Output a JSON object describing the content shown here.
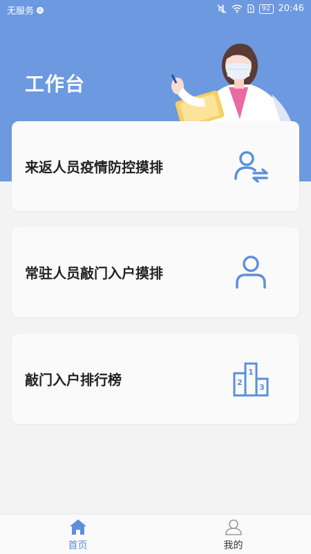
{
  "colors": {
    "accent": "#6c99e0",
    "icon_blue": "#5b8fdc",
    "background": "#f3f3f3",
    "card": "#fafafa"
  },
  "status_bar": {
    "carrier": "无服务",
    "battery": "92",
    "time": "20:46",
    "icons": [
      "mute-icon",
      "wifi-icon",
      "sim-icon",
      "battery-icon"
    ]
  },
  "header": {
    "title": "工作台"
  },
  "cards": [
    {
      "label": "来返人员疫情防控摸排",
      "icon": "person-swap-icon"
    },
    {
      "label": "常驻人员敲门入户摸排",
      "icon": "person-icon"
    },
    {
      "label": "敲门入户排行榜",
      "icon": "podium-icon"
    }
  ],
  "podium": {
    "places": [
      "2",
      "1",
      "3"
    ]
  },
  "tabbar": {
    "items": [
      {
        "label": "首页",
        "icon": "home-icon",
        "active": true
      },
      {
        "label": "我的",
        "icon": "user-icon",
        "active": false
      }
    ]
  }
}
